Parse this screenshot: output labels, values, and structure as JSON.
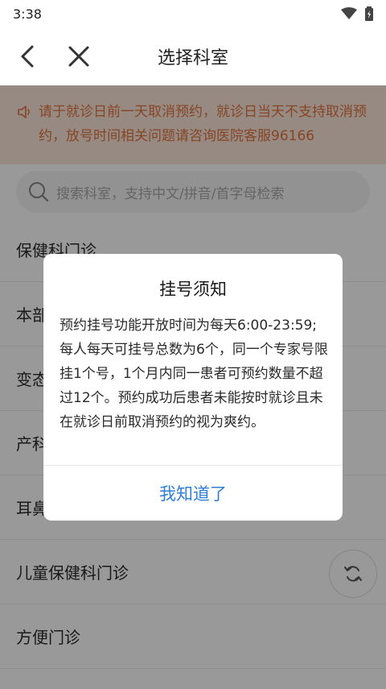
{
  "status_bar": {
    "time": "3:38"
  },
  "nav": {
    "title": "选择科室"
  },
  "notice": {
    "text": "请于就诊日前一天取消预约，就诊日当天不支持取消预约，放号时间相关问题请咨询医院客服96166"
  },
  "search": {
    "placeholder": "搜索科室，支持中文/拼音/首字母检索"
  },
  "departments": [
    "保健科门诊",
    "本部",
    "变态",
    "产科",
    "耳鼻",
    "儿童保健科门诊",
    "方便门诊"
  ],
  "dialog": {
    "title": "挂号须知",
    "body": "预约挂号功能开放时间为每天6:00-23:59;每人每天可挂号总数为6个，同一个专家号限挂1个号，1个月内同一患者可预约数量不超过12个。预约成功后患者未能按时就诊且未在就诊日前取消预约的视为爽约。",
    "confirm_label": "我知道了"
  },
  "colors": {
    "notice_text": "#e2733d",
    "notice_bg": "#fbe7da",
    "link_blue": "#2f7fd6"
  },
  "icons": [
    "back-arrow-icon",
    "close-icon",
    "speaker-icon",
    "search-icon",
    "refresh-icon",
    "wifi-icon",
    "battery-icon"
  ]
}
